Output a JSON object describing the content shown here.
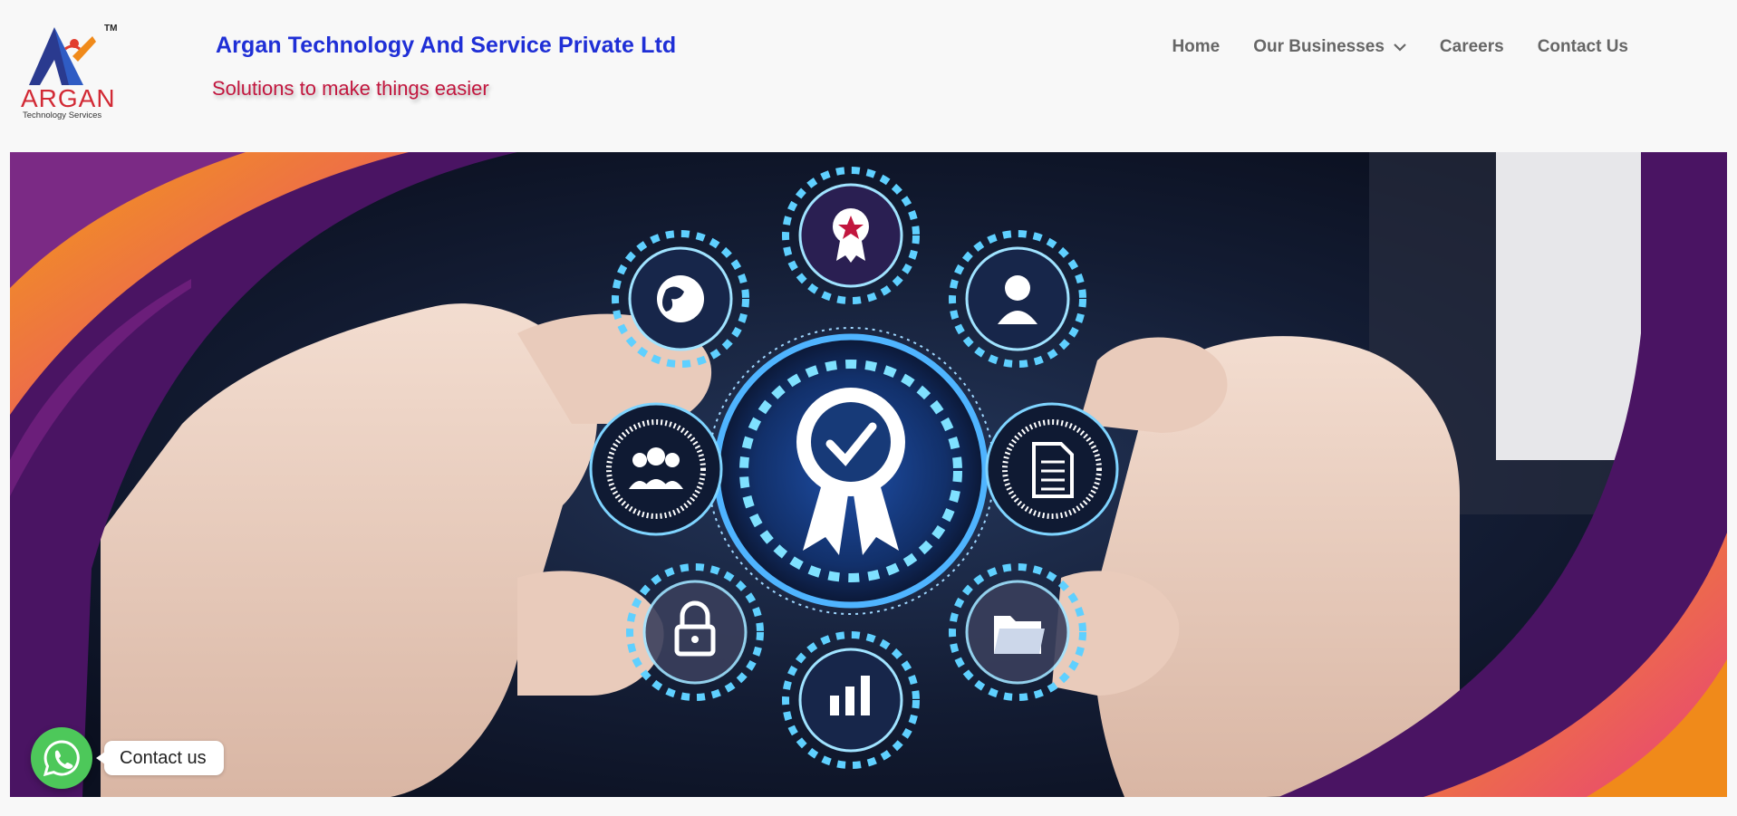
{
  "header": {
    "logo": {
      "wordmark": "ARGAN",
      "subtitle": "Technology Services",
      "tm": "TM"
    },
    "company_name": "Argan Technology And Service Private Ltd",
    "tagline": "Solutions to make things easier"
  },
  "nav": {
    "items": [
      {
        "label": "Home",
        "has_dropdown": false
      },
      {
        "label": "Our Businesses",
        "has_dropdown": true
      },
      {
        "label": "Careers",
        "has_dropdown": false
      },
      {
        "label": "Contact Us",
        "has_dropdown": false
      }
    ]
  },
  "hero": {
    "image_subject": "hands holding glowing certification badge with surrounding icons",
    "icons": [
      "award-icon",
      "globe-icon",
      "user-icon",
      "team-icon",
      "document-icon",
      "lock-icon",
      "bar-chart-icon",
      "folder-icon",
      "check-badge-icon"
    ]
  },
  "whatsapp": {
    "label": "Contact us"
  },
  "colors": {
    "company_name": "#1f2fd6",
    "tagline": "#c2163e",
    "nav_text": "#666666",
    "whatsapp": "#4dc85a",
    "hero_purple": "#4a1463",
    "hero_orange": "#f08a1a"
  }
}
